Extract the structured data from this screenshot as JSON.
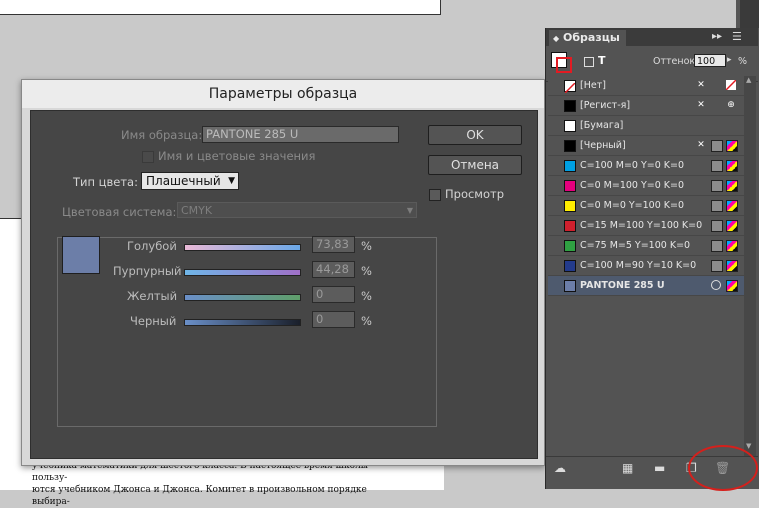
{
  "document": {
    "lines": [
      "учебника математики для шестого класса. В настоящее время школы пользу-",
      "ются учебником Джонса и Джонса. Комитет в произвольном порядке выбира-"
    ]
  },
  "dialog": {
    "title": "Параметры образца",
    "swatch_name_label": "Имя образца:",
    "swatch_name_value": "PANTONE 285 U",
    "name_with_values_label": "Имя и цветовые значения",
    "color_type_label": "Тип цвета:",
    "color_type_value": "Плашечный",
    "color_system_label": "Цветовая система:",
    "color_system_value": "CMYK",
    "preview_label": "Просмотр",
    "ok_label": "OK",
    "cancel_label": "Отмена",
    "preview_color": "#6c7ea8",
    "channels": [
      {
        "label": "Голубой",
        "value": "73,83",
        "unit": "%",
        "level": 73.83
      },
      {
        "label": "Пурпурный",
        "value": "44,28",
        "unit": "%",
        "level": 44.28
      },
      {
        "label": "Желтый",
        "value": "0",
        "unit": "%",
        "level": 0
      },
      {
        "label": "Черный",
        "value": "0",
        "unit": "%",
        "level": 0
      }
    ]
  },
  "panel": {
    "title": "Образцы",
    "tint_label": "Оттенок:",
    "tint_value": "100",
    "tint_unit": "%",
    "swatches": [
      {
        "name": "[Нет]",
        "color": "none"
      },
      {
        "name": "[Регист-я]",
        "color": "#000000"
      },
      {
        "name": "[Бумага]",
        "color": "#ffffff"
      },
      {
        "name": "[Черный]",
        "color": "#000000"
      },
      {
        "name": "C=100 M=0 Y=0 K=0",
        "color": "#00a0e3"
      },
      {
        "name": "C=0 M=100 Y=0 K=0",
        "color": "#e5007e"
      },
      {
        "name": "C=0 M=0 Y=100 K=0",
        "color": "#ffed00"
      },
      {
        "name": "C=15 M=100 Y=100 K=0",
        "color": "#d0202e"
      },
      {
        "name": "C=75 M=5 Y=100 K=0",
        "color": "#2fa142"
      },
      {
        "name": "C=100 M=90 Y=10 K=0",
        "color": "#233b8c"
      },
      {
        "name": "PANTONE 285 U",
        "color": "#6c7ea8",
        "selected": true
      }
    ]
  }
}
